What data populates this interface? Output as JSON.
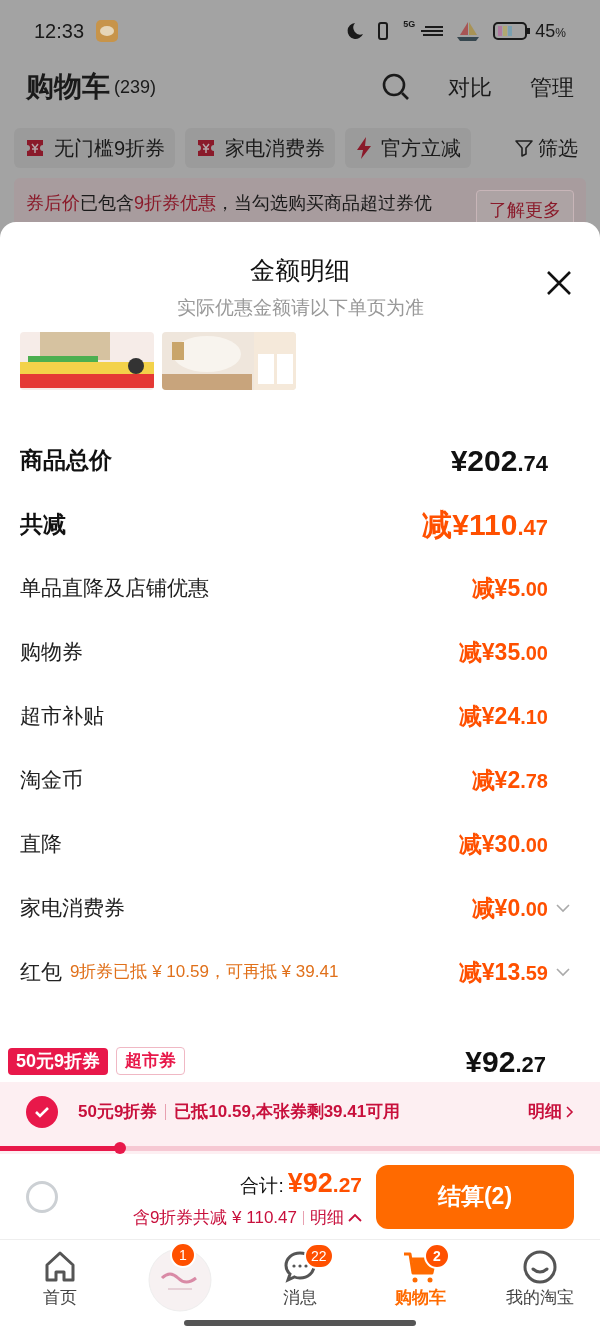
{
  "status_bar": {
    "time": "12:33",
    "network": "5G",
    "battery": "45",
    "battery_unit": "%"
  },
  "header": {
    "title": "购物车",
    "count": "(239)",
    "actions": [
      "对比",
      "管理"
    ]
  },
  "chips": [
    {
      "label": "无门槛9折券",
      "kind": "coupon"
    },
    {
      "label": "家电消费券",
      "kind": "coupon"
    },
    {
      "label": "官方立减",
      "kind": "bolt"
    },
    {
      "label": "筛选",
      "kind": "filter"
    }
  ],
  "banner": {
    "segments": [
      {
        "text": "券后价",
        "highlight": true
      },
      {
        "text": "已包含",
        "highlight": false
      },
      {
        "text": "9折券优惠",
        "highlight": true
      },
      {
        "text": "，当勾选购买商品超过券优",
        "highlight": false
      }
    ],
    "button": "了解更多"
  },
  "sheet": {
    "title": "金额明细",
    "subtitle": "实际优惠金额请以下单页为准",
    "rows": [
      {
        "kind": "total",
        "label": "商品总价",
        "amount": "¥202",
        "cents": ".74",
        "expandable": false
      },
      {
        "kind": "sum",
        "label": "共减",
        "amount": "减¥110",
        "cents": ".47",
        "expandable": false
      },
      {
        "kind": "item",
        "label": "单品直降及店铺优惠",
        "amount": "减¥5",
        "cents": ".00",
        "expandable": false
      },
      {
        "kind": "item",
        "label": "购物券",
        "amount": "减¥35",
        "cents": ".00",
        "expandable": false
      },
      {
        "kind": "item",
        "label": "超市补贴",
        "amount": "减¥24",
        "cents": ".10",
        "expandable": false
      },
      {
        "kind": "item",
        "label": "淘金币",
        "amount": "减¥2",
        "cents": ".78",
        "expandable": false
      },
      {
        "kind": "item",
        "label": "直降",
        "amount": "减¥30",
        "cents": ".00",
        "expandable": false
      },
      {
        "kind": "item",
        "label": "家电消费券",
        "amount": "减¥0",
        "cents": ".00",
        "expandable": true
      },
      {
        "kind": "item",
        "label": "红包",
        "note": "9折券已抵 ¥ 10.59，可再抵 ¥ 39.41",
        "amount": "减¥13",
        "cents": ".59",
        "expandable": true
      }
    ]
  },
  "item_peek": {
    "tags": [
      {
        "label": "50元9折券",
        "kind": "filled"
      },
      {
        "label": "超市券",
        "kind": "outline"
      }
    ],
    "price": "¥92",
    "cents": ".27"
  },
  "coupon_bar": {
    "checked": true,
    "name": "50元9折券",
    "detail": "已抵10.59,本张券剩39.41可用",
    "link": "明细",
    "level": 0.2
  },
  "checkout": {
    "select_all": false,
    "total_label": "合计:",
    "total": "¥92",
    "cents": ".27",
    "saving": "含9折券共减 ¥ 110.47",
    "detail": "明细",
    "button": "结算(2)"
  },
  "tabs": [
    {
      "label": "首页",
      "kind": "home",
      "selected": false
    },
    {
      "kind": "logo",
      "badge": "1",
      "selected": false
    },
    {
      "label": "消息",
      "kind": "chat",
      "badge": "22",
      "selected": false
    },
    {
      "label": "购物车",
      "kind": "cart",
      "badge": "2",
      "selected": true
    },
    {
      "label": "我的淘宝",
      "kind": "face",
      "selected": false
    }
  ]
}
